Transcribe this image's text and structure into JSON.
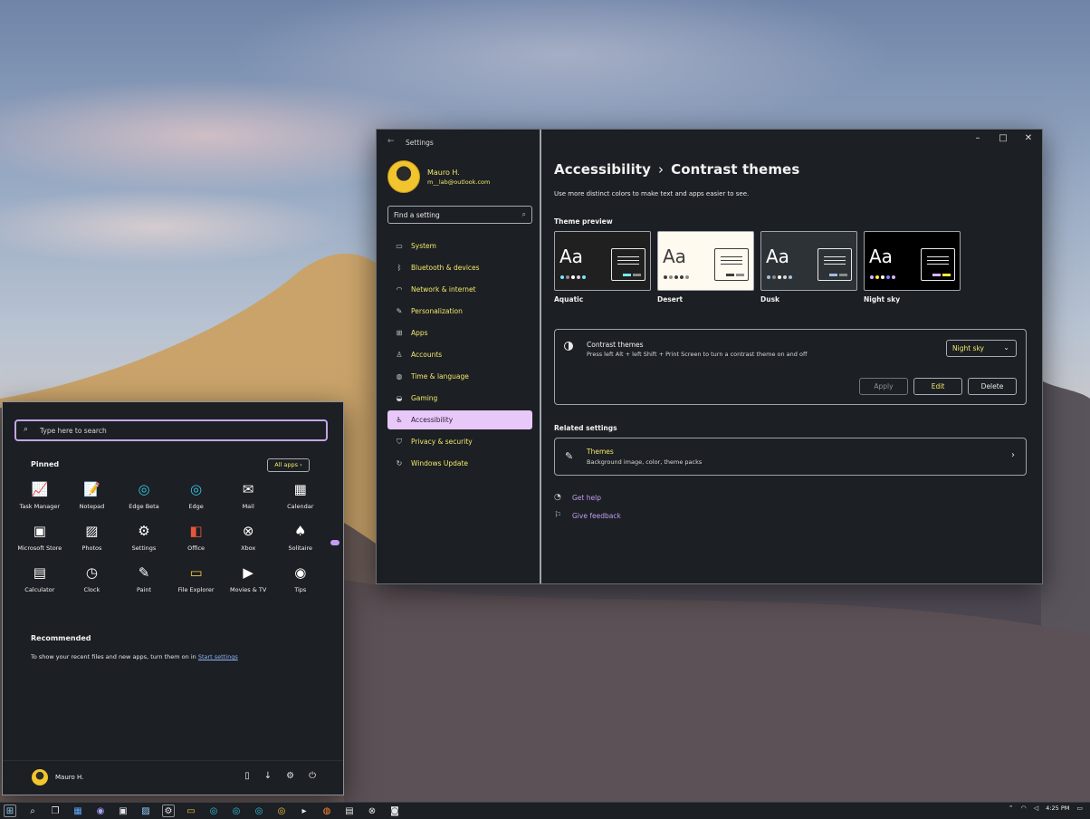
{
  "settings": {
    "title": "Settings",
    "user": {
      "name": "Mauro H.",
      "email": "m__lab@outlook.com"
    },
    "search_placeholder": "Find a setting",
    "nav": [
      {
        "label": "System",
        "icon": "monitor-icon"
      },
      {
        "label": "Bluetooth & devices",
        "icon": "bluetooth-icon"
      },
      {
        "label": "Network & internet",
        "icon": "wifi-icon"
      },
      {
        "label": "Personalization",
        "icon": "pen-icon"
      },
      {
        "label": "Apps",
        "icon": "apps-icon"
      },
      {
        "label": "Accounts",
        "icon": "person-icon"
      },
      {
        "label": "Time & language",
        "icon": "globe-icon"
      },
      {
        "label": "Gaming",
        "icon": "gamepad-icon"
      },
      {
        "label": "Accessibility",
        "icon": "accessibility-icon",
        "active": true
      },
      {
        "label": "Privacy & security",
        "icon": "shield-icon"
      },
      {
        "label": "Windows Update",
        "icon": "update-icon"
      }
    ],
    "breadcrumb": {
      "parent": "Accessibility",
      "current": "Contrast themes"
    },
    "subtitle": "Use more distinct colors to make text and apps easier to see.",
    "theme_preview_title": "Theme preview",
    "themes": [
      {
        "name": "Aquatic",
        "sample": "Aa",
        "bg": "#202020",
        "fg": "#ffffff",
        "accent": "#75e9fc",
        "mini_bg": "#202020",
        "mini_border": "#e8e8e8"
      },
      {
        "name": "Desert",
        "sample": "Aa",
        "bg": "#fffaef",
        "fg": "#3d3d3d",
        "accent": "#3d3d3d",
        "mini_bg": "#fffaef",
        "mini_border": "#3d3d3d"
      },
      {
        "name": "Dusk",
        "sample": "Aa",
        "bg": "#2d3236",
        "fg": "#ffffff",
        "accent": "#a1bfde",
        "mini_bg": "#2d3236",
        "mini_border": "#e8e8e8"
      },
      {
        "name": "Night sky",
        "sample": "Aa",
        "bg": "#000000",
        "fg": "#ffffff",
        "accent": "#d6b4fd",
        "mini_bg": "#000000",
        "mini_border": "#e8e8e8"
      }
    ],
    "contrast": {
      "title": "Contrast themes",
      "description": "Press left Alt + left Shift + Print Screen to turn a contrast theme on and off",
      "selected": "Night sky",
      "apply_label": "Apply",
      "edit_label": "Edit",
      "delete_label": "Delete"
    },
    "related_title": "Related settings",
    "related": {
      "title": "Themes",
      "description": "Background image, color, theme packs"
    },
    "links": {
      "help": "Get help",
      "feedback": "Give feedback"
    }
  },
  "start": {
    "search_placeholder": "Type here to search",
    "pinned_title": "Pinned",
    "all_apps_label": "All apps",
    "apps": [
      {
        "label": "Task Manager",
        "icon": "task-manager-icon",
        "glyph": "📈"
      },
      {
        "label": "Notepad",
        "icon": "notepad-icon",
        "glyph": "📝"
      },
      {
        "label": "Edge Beta",
        "icon": "edge-beta-icon",
        "glyph": "◎"
      },
      {
        "label": "Edge",
        "icon": "edge-icon",
        "glyph": "◎"
      },
      {
        "label": "Mail",
        "icon": "mail-icon",
        "glyph": "✉"
      },
      {
        "label": "Calendar",
        "icon": "calendar-icon",
        "glyph": "▦"
      },
      {
        "label": "Microsoft Store",
        "icon": "store-icon",
        "glyph": "▣"
      },
      {
        "label": "Photos",
        "icon": "photos-icon",
        "glyph": "▨"
      },
      {
        "label": "Settings",
        "icon": "settings-gear-icon",
        "glyph": "⚙"
      },
      {
        "label": "Office",
        "icon": "office-icon",
        "glyph": "◧"
      },
      {
        "label": "Xbox",
        "icon": "xbox-icon",
        "glyph": "⊗"
      },
      {
        "label": "Solitaire",
        "icon": "solitaire-icon",
        "glyph": "♠"
      },
      {
        "label": "Calculator",
        "icon": "calculator-icon",
        "glyph": "▤"
      },
      {
        "label": "Clock",
        "icon": "clock-icon",
        "glyph": "◷"
      },
      {
        "label": "Paint",
        "icon": "paint-icon",
        "glyph": "✎"
      },
      {
        "label": "File Explorer",
        "icon": "folder-icon",
        "glyph": "▭"
      },
      {
        "label": "Movies & TV",
        "icon": "movies-icon",
        "glyph": "▶"
      },
      {
        "label": "Tips",
        "icon": "tips-icon",
        "glyph": "◉"
      }
    ],
    "recommended_title": "Recommended",
    "recommended_text": "To show your recent files and new apps, turn them on in",
    "recommended_link": "Start settings",
    "user_name": "Mauro H."
  },
  "taskbar": {
    "time": "4:25 PM"
  }
}
